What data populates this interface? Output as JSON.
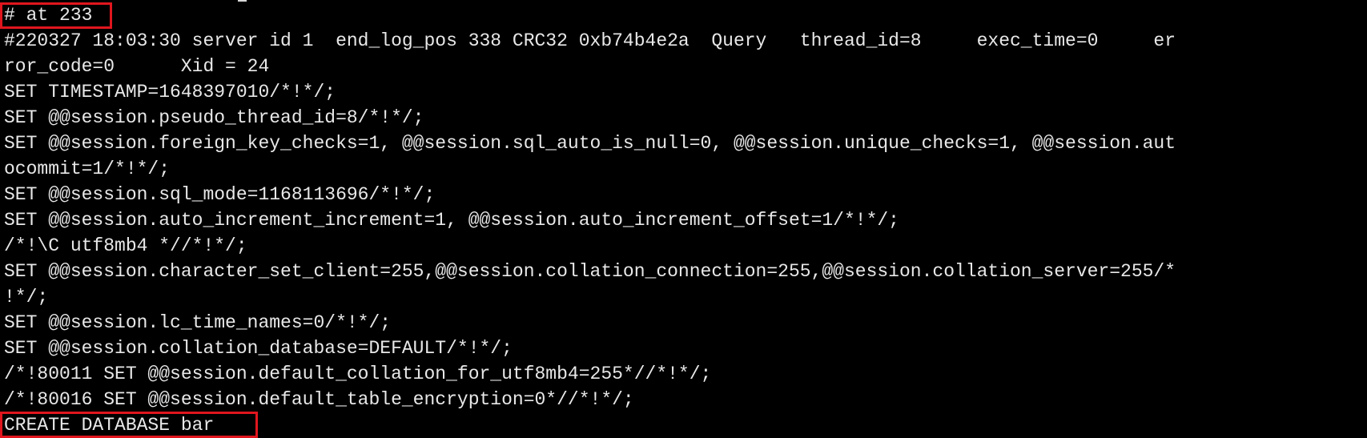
{
  "terminal": {
    "background": "#000000",
    "text_color": "#e8e8e8",
    "highlight_color": "#e0161e",
    "lines": [
      "# at 233",
      "#220327 18:03:30 server id 1  end_log_pos 338 CRC32 0xb74b4e2a  Query   thread_id=8     exec_time=0     er",
      "ror_code=0      Xid = 24",
      "SET TIMESTAMP=1648397010/*!*/;",
      "SET @@session.pseudo_thread_id=8/*!*/;",
      "SET @@session.foreign_key_checks=1, @@session.sql_auto_is_null=0, @@session.unique_checks=1, @@session.aut",
      "ocommit=1/*!*/;",
      "SET @@session.sql_mode=1168113696/*!*/;",
      "SET @@session.auto_increment_increment=1, @@session.auto_increment_offset=1/*!*/;",
      "/*!\\C utf8mb4 *//*!*/;",
      "SET @@session.character_set_client=255,@@session.collation_connection=255,@@session.collation_server=255/*",
      "!*/;",
      "SET @@session.lc_time_names=0/*!*/;",
      "SET @@session.collation_database=DEFAULT/*!*/;",
      "/*!80011 SET @@session.default_collation_for_utf8mb4=255*//*!*/;",
      "/*!80016 SET @@session.default_table_encryption=0*//*!*/;",
      "CREATE DATABASE bar"
    ]
  }
}
